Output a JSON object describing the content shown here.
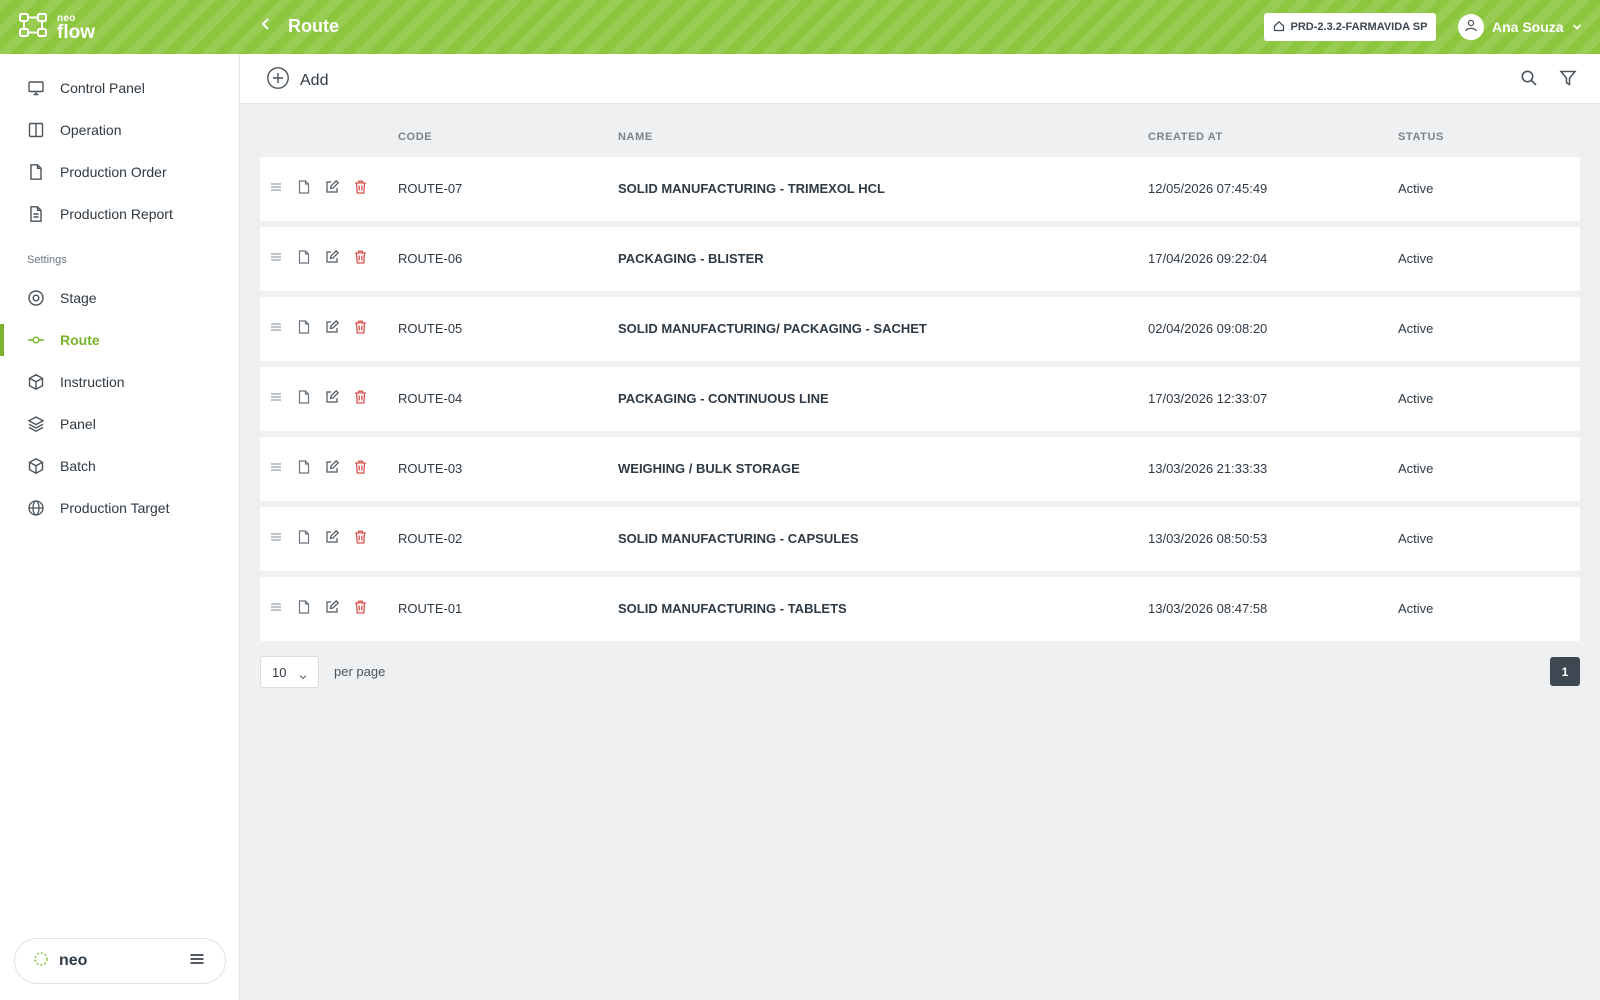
{
  "brand": {
    "small": "neo",
    "big": "flow",
    "footer_name": "neo"
  },
  "header": {
    "title": "Route",
    "environment": "PRD-2.3.2-FARMAVIDA SP",
    "user_name": "Ana Souza"
  },
  "sidebar": {
    "items": [
      {
        "label": "Control Panel",
        "icon": "monitor-icon"
      },
      {
        "label": "Operation",
        "icon": "columns-icon"
      },
      {
        "label": "Production Order",
        "icon": "file-icon"
      },
      {
        "label": "Production Report",
        "icon": "file-text-icon"
      }
    ],
    "settings_label": "Settings",
    "settings_items": [
      {
        "label": "Stage",
        "icon": "target-icon"
      },
      {
        "label": "Route",
        "icon": "route-icon",
        "active": true
      },
      {
        "label": "Instruction",
        "icon": "box-icon"
      },
      {
        "label": "Panel",
        "icon": "layers-icon"
      },
      {
        "label": "Batch",
        "icon": "box-icon"
      },
      {
        "label": "Production Target",
        "icon": "globe-icon"
      }
    ]
  },
  "toolbar": {
    "add_label": "Add"
  },
  "table": {
    "columns": [
      "CODE",
      "NAME",
      "CREATED AT",
      "STATUS"
    ],
    "rows": [
      {
        "code": "ROUTE-07",
        "name": "SOLID MANUFACTURING - TRIMEXOL HCL",
        "created_at": "12/05/2026 07:45:49",
        "status": "Active"
      },
      {
        "code": "ROUTE-06",
        "name": "PACKAGING - BLISTER",
        "created_at": "17/04/2026 09:22:04",
        "status": "Active"
      },
      {
        "code": "ROUTE-05",
        "name": "SOLID MANUFACTURING/ PACKAGING - SACHET",
        "created_at": "02/04/2026 09:08:20",
        "status": "Active"
      },
      {
        "code": "ROUTE-04",
        "name": "PACKAGING - CONTINUOUS LINE",
        "created_at": "17/03/2026 12:33:07",
        "status": "Active"
      },
      {
        "code": "ROUTE-03",
        "name": "WEIGHING / BULK STORAGE",
        "created_at": "13/03/2026 21:33:33",
        "status": "Active"
      },
      {
        "code": "ROUTE-02",
        "name": "SOLID MANUFACTURING - CAPSULES",
        "created_at": "13/03/2026 08:50:53",
        "status": "Active"
      },
      {
        "code": "ROUTE-01",
        "name": "SOLID MANUFACTURING - TABLETS",
        "created_at": "13/03/2026 08:47:58",
        "status": "Active"
      }
    ]
  },
  "pagination": {
    "per_page": "10",
    "per_page_label": "per page",
    "current_page": "1"
  },
  "colors": {
    "brand_green": "#8cc63f",
    "active_green": "#7ab32e",
    "danger_red": "#d9534f",
    "page_bg": "#eef0f2"
  }
}
